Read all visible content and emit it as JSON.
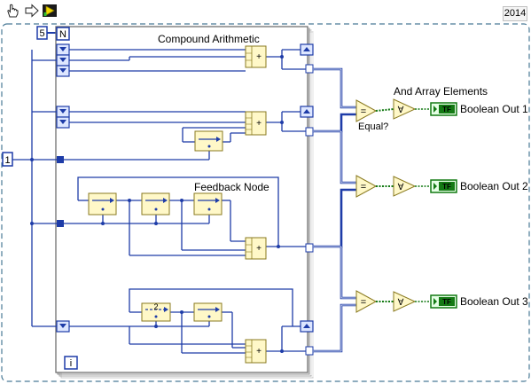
{
  "toolbar": {
    "year": "2014",
    "buttons": [
      {
        "name": "probe-tool-icon",
        "icon": "hand-pointer-icon"
      },
      {
        "name": "run-arrow-icon",
        "icon": "arrow-right-icon"
      },
      {
        "name": "highlight-execution-icon",
        "icon": "lightbulb-icon"
      }
    ]
  },
  "diagram": {
    "constants": {
      "n_value": "5",
      "count_terminal": "N",
      "init_value": "1",
      "iteration_terminal": "i"
    },
    "labels": {
      "compound_arithmetic": "Compound Arithmetic",
      "feedback_node": "Feedback Node",
      "and_array_elements": "And Array Elements",
      "equal": "Equal?"
    },
    "indicators": [
      {
        "tag": "TF",
        "label": "Boolean Out 1"
      },
      {
        "tag": "TF",
        "label": "Boolean Out 2"
      },
      {
        "tag": "TF",
        "label": "Boolean Out 3"
      }
    ],
    "colors": {
      "wire_numeric": "#1e3ca8",
      "wire_boolean": "#147a14",
      "node_fill": "#fff8c8",
      "node_border": "#8a7a20",
      "loop_border": "#707070",
      "frame_dash": "#4a7a96"
    }
  }
}
